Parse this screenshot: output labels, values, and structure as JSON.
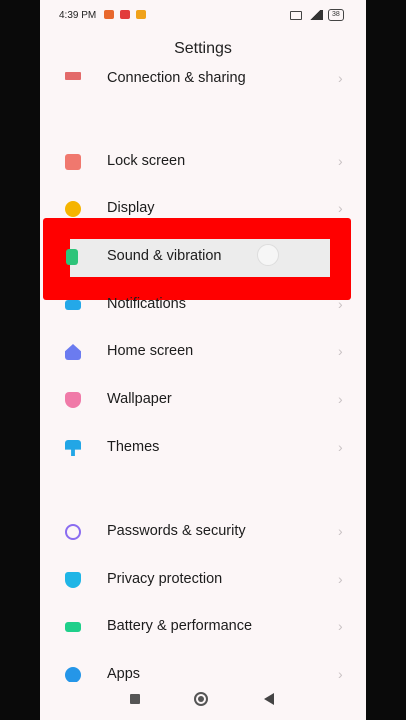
{
  "status_bar": {
    "time": "4:39 PM",
    "battery": "38"
  },
  "page_title": "Settings",
  "rows": [
    {
      "label": "Connection & sharing",
      "icon": "connection-icon",
      "color": "#e36a6a"
    },
    {
      "label": "Lock screen",
      "icon": "lock-icon",
      "color": "#f0786e"
    },
    {
      "label": "Display",
      "icon": "sun-icon",
      "color": "#f5b400"
    },
    {
      "label": "Sound & vibration",
      "icon": "speaker-icon",
      "color": "#2ec47a"
    },
    {
      "label": "Notifications",
      "icon": "notification-icon",
      "color": "#24a8e8"
    },
    {
      "label": "Home screen",
      "icon": "home-icon",
      "color": "#6b7bf0"
    },
    {
      "label": "Wallpaper",
      "icon": "wallpaper-icon",
      "color": "#f07aa8"
    },
    {
      "label": "Themes",
      "icon": "themes-icon",
      "color": "#22a6e6"
    },
    {
      "label": "Passwords & security",
      "icon": "fingerprint-icon",
      "color": "#8a6cf0"
    },
    {
      "label": "Privacy protection",
      "icon": "privacy-icon",
      "color": "#1fb5e6"
    },
    {
      "label": "Battery & performance",
      "icon": "battery-icon",
      "color": "#1fcf8a"
    },
    {
      "label": "Apps",
      "icon": "apps-icon",
      "color": "#2596e8"
    }
  ],
  "chevron": "›",
  "highlight_color": "#ff0000"
}
